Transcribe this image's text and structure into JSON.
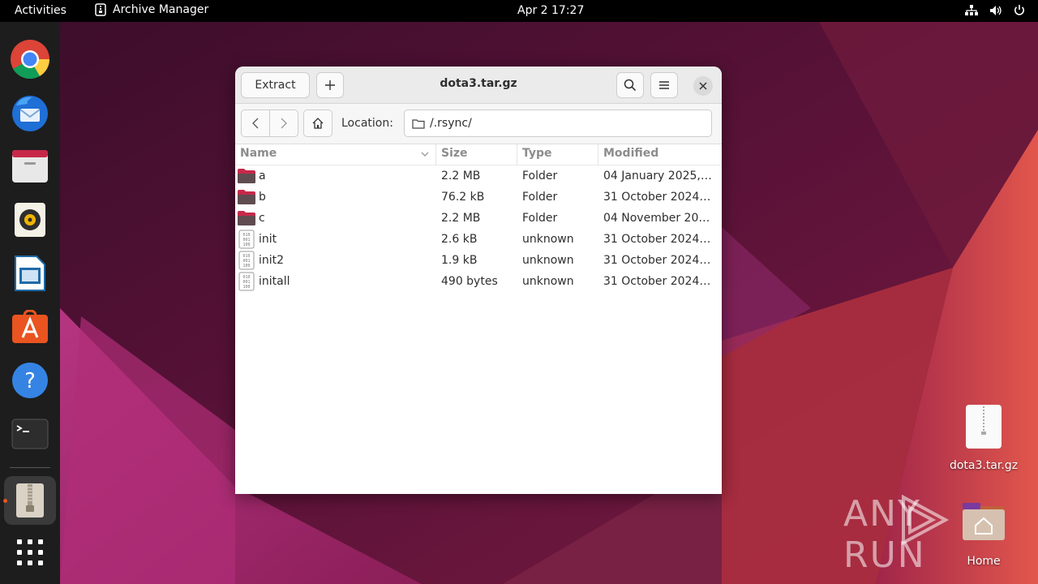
{
  "topbar": {
    "activities": "Activities",
    "app_name": "Archive Manager",
    "clock": "Apr 2  17:27"
  },
  "window": {
    "title": "dota3.tar.gz",
    "extract_label": "Extract",
    "location_label": "Location:",
    "location_value": "/.rsync/"
  },
  "table": {
    "headers": {
      "name": "Name",
      "size": "Size",
      "type": "Type",
      "modified": "Modified"
    },
    "rows": [
      {
        "name": "a",
        "size": "2.2 MB",
        "type": "Folder",
        "modified": "04 January 2025,…",
        "kind": "folder"
      },
      {
        "name": "b",
        "size": "76.2 kB",
        "type": "Folder",
        "modified": "31 October 2024…",
        "kind": "folder"
      },
      {
        "name": "c",
        "size": "2.2 MB",
        "type": "Folder",
        "modified": "04 November 20…",
        "kind": "folder"
      },
      {
        "name": "init",
        "size": "2.6 kB",
        "type": "unknown",
        "modified": "31 October 2024…",
        "kind": "binary"
      },
      {
        "name": "init2",
        "size": "1.9 kB",
        "type": "unknown",
        "modified": "31 October 2024…",
        "kind": "binary"
      },
      {
        "name": "initall",
        "size": "490 bytes",
        "type": "unknown",
        "modified": "31 October 2024…",
        "kind": "binary"
      }
    ]
  },
  "desktop": {
    "archive_icon_label": "dota3.tar.gz",
    "home_icon_label": "Home",
    "watermark": "ANY RUN"
  },
  "dock": {
    "items": [
      "chrome-icon",
      "thunderbird-icon",
      "files-icon",
      "rhythmbox-icon",
      "libreoffice-impress-icon",
      "app-center-icon",
      "help-icon",
      "terminal-icon",
      "archive-manager-icon",
      "show-apps-icon"
    ]
  },
  "colors": {
    "accent": "#e95420",
    "folder_body": "#6e5a5e",
    "folder_tab": "#c7284a"
  }
}
